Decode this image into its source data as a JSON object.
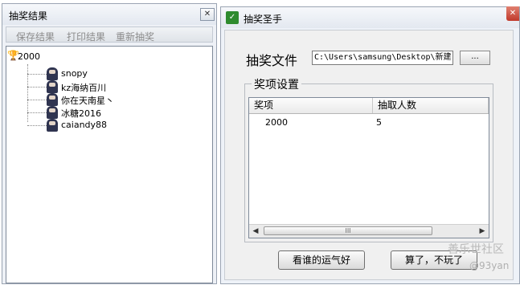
{
  "left_window": {
    "title": "抽奖结果",
    "close_label": "✕",
    "toolbar": {
      "save": "保存结果",
      "print": "打印结果",
      "redraw": "重新抽奖"
    },
    "tree": {
      "root_label": "2000",
      "root_icon": "trophy-icon",
      "children": [
        "snopy",
        "kz海纳百川",
        "你在天南星丶",
        "冰糖2016",
        "caiandy88"
      ]
    }
  },
  "right_window": {
    "title": "抽奖圣手",
    "app_icon": "app-logo-icon",
    "close_label": "✕",
    "file_label": "抽奖文件",
    "file_path": "C:\\Users\\samsung\\Desktop\\新建",
    "browse_label": "...",
    "group_title": "奖项设置",
    "columns": [
      "奖项",
      "抽取人数"
    ],
    "rows": [
      {
        "prize": "2000",
        "count": "5"
      }
    ],
    "scroll": {
      "thumb_label": "III",
      "left_arrow": "◀",
      "right_arrow": "▶"
    },
    "lucky_button": "看谁的运气好",
    "cancel_button": "算了，不玩了"
  },
  "watermark": {
    "line1": "善乐世社区",
    "line2": "@93yan"
  },
  "colors": {
    "app_icon_green": "#2e8b2e",
    "close_red": "#c0392b",
    "trophy_gold": "#b88a00"
  }
}
